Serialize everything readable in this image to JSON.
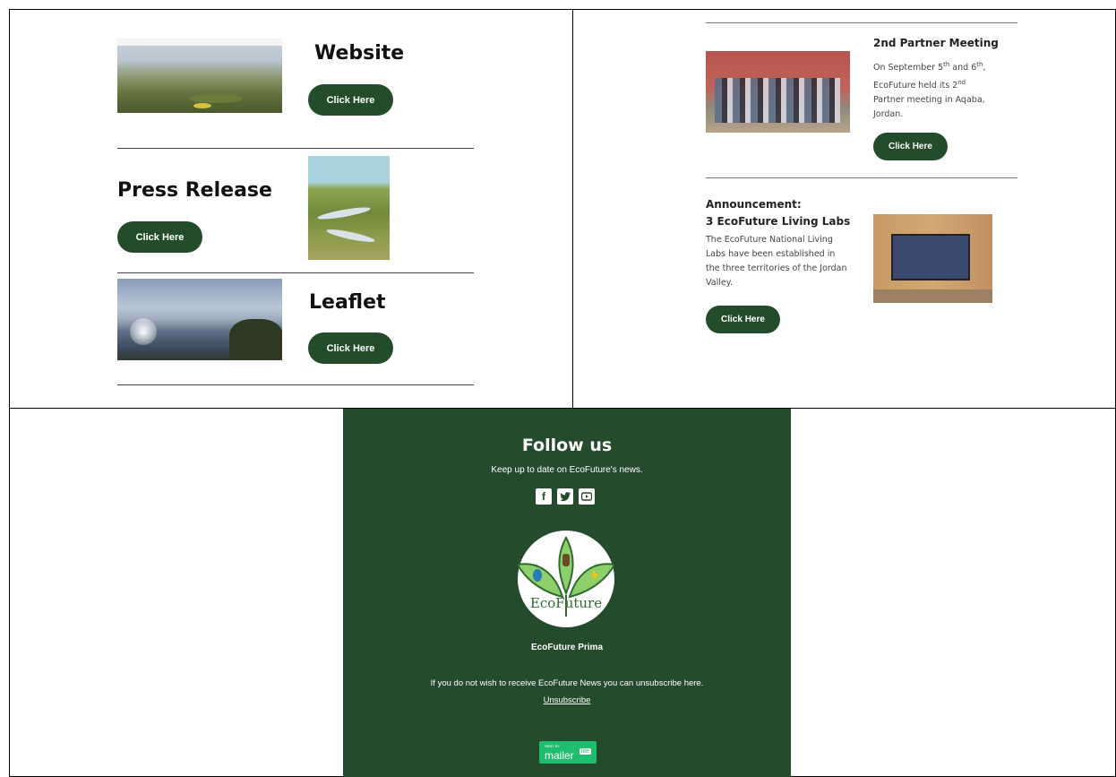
{
  "left_panel": {
    "website": {
      "title": "Website",
      "button": "Click Here"
    },
    "press": {
      "title": "Press Release",
      "button": "Click Here"
    },
    "leaflet": {
      "title": "Leaflet",
      "button": "Click Here"
    }
  },
  "right_panel": {
    "meeting": {
      "title": "2nd Partner Meeting",
      "text_1": "On September 5",
      "sup_1": "th",
      "text_2": " and 6",
      "sup_2": "th",
      "text_3": ",",
      "line_2a": "EcoFuture held its 2",
      "sup_3": "nd",
      "line_3": "Partner meeting in Aqaba,",
      "line_4": "Jordan.",
      "button": "Click Here"
    },
    "announcement": {
      "label": "Announcement:",
      "title": "3 EcoFuture Living Labs",
      "line_1": "The EcoFuture National Living",
      "line_2": "Labs have been established in",
      "line_3": "the three territories of the Jordan",
      "line_4": "Valley.",
      "button": "Click Here"
    }
  },
  "footer": {
    "heading": "Follow us",
    "subheading": "Keep up to date on EcoFuture's news.",
    "social_icons": [
      "facebook-icon",
      "twitter-icon",
      "youtube-icon"
    ],
    "logo_text": "EcoFuture",
    "org_name": "EcoFuture Prima",
    "unsubscribe_note": "If you do not wish to receive EcoFuture News you can unsubscribe here.",
    "unsubscribe_link": "Unsubscribe",
    "badge_top": "SENT BY",
    "badge_main": "mailer",
    "badge_tag": "lite"
  },
  "colors": {
    "brand_green": "#244b2b",
    "button_green": "#234d2a"
  }
}
